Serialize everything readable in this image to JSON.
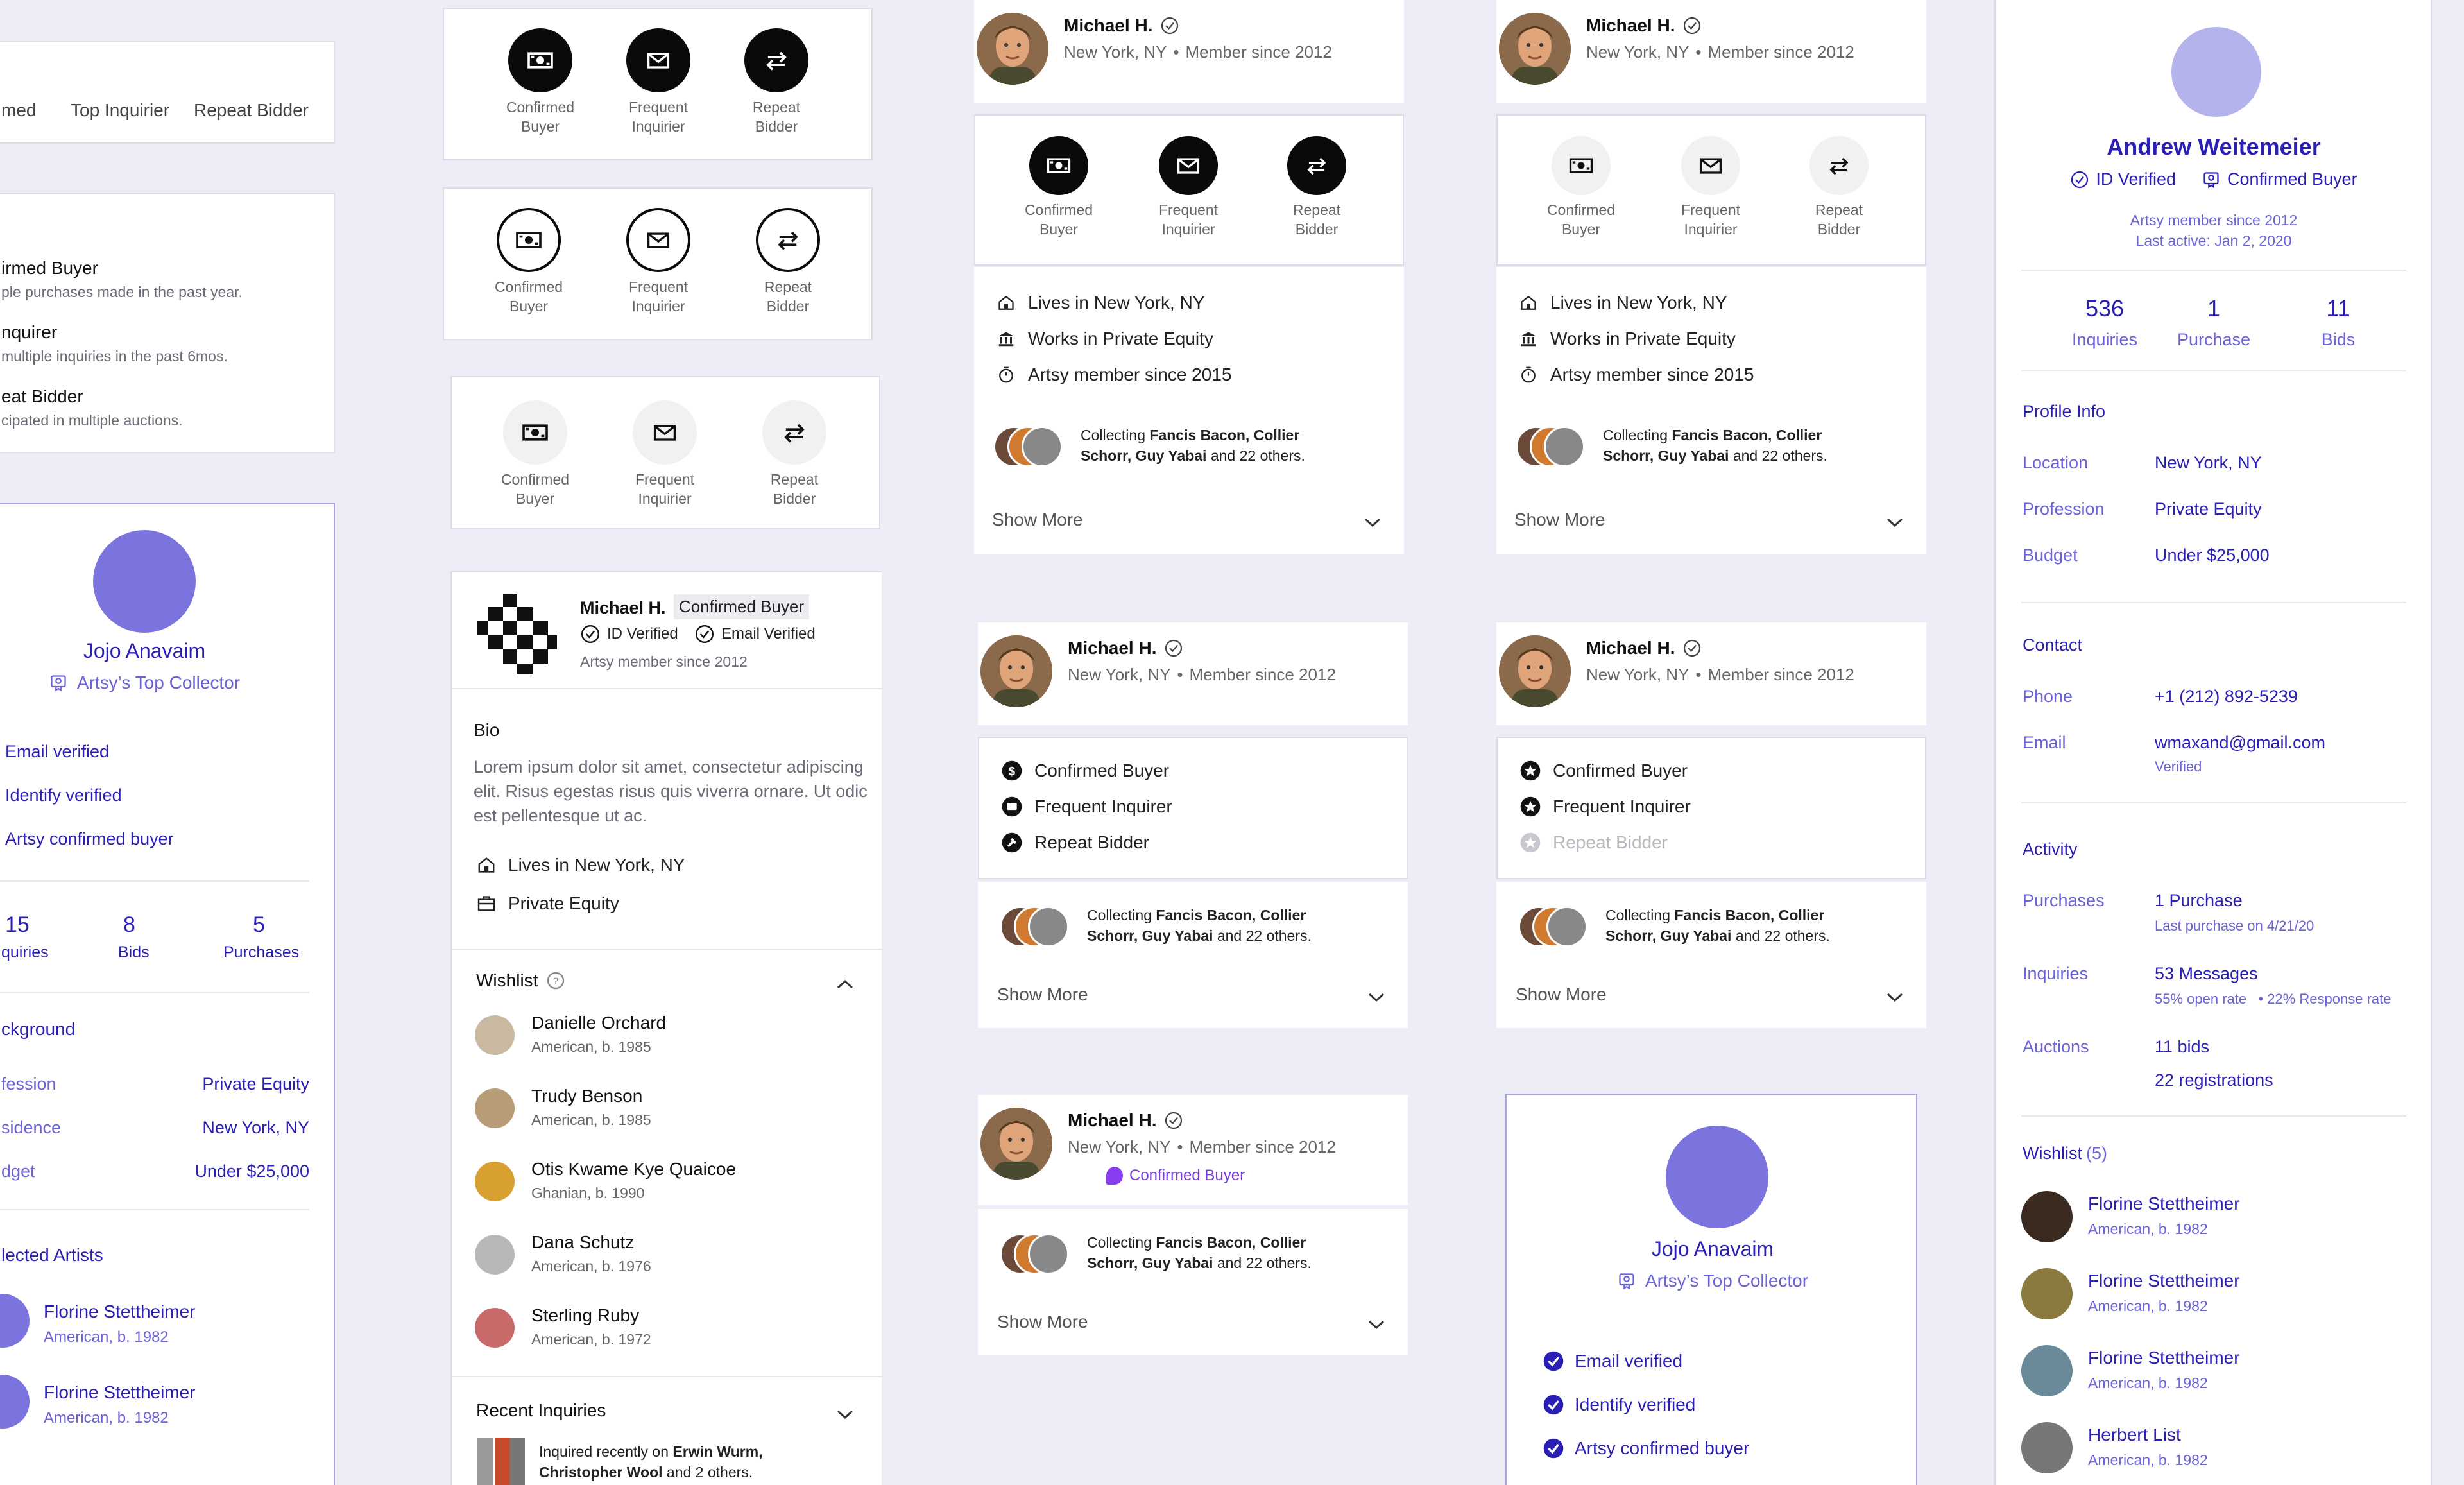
{
  "tabs_card": {
    "items": [
      "med",
      "Top Inquirier",
      "Repeat Bidder"
    ]
  },
  "desc_card": {
    "items": [
      {
        "title": "irmed Buyer",
        "desc": "ple purchases made in the past year."
      },
      {
        "title": "nquirer",
        "desc": "multiple inquiries in the past 6mos."
      },
      {
        "title": "eat Bidder",
        "desc": "cipated in multiple auctions."
      }
    ]
  },
  "badges": {
    "buyer": [
      "Confirmed",
      "Buyer"
    ],
    "inquirer": [
      "Frequent",
      "Inquirier"
    ],
    "bidder": [
      "Repeat",
      "Bidder"
    ]
  },
  "user": {
    "name": "Michael H.",
    "location": "New York, NY",
    "member": "Member since 2012",
    "sep": "•"
  },
  "details": {
    "lives": "Lives in New York, NY",
    "works": "Works in Private Equity",
    "since": "Artsy member since 2015"
  },
  "collecting": {
    "prefix": "Collecting ",
    "artists1": "Fancis Bacon, Collier",
    "artists2": "Schorr, Guy Yabai",
    "suffix": " and 22 others."
  },
  "show_more": "Show More",
  "badge_list": {
    "buyer": "Confirmed Buyer",
    "inquirer": "Frequent Inquirer",
    "bidder": "Repeat Bidder"
  },
  "confirmed_buyer_tag": "Confirmed Buyer",
  "left_profile": {
    "name": "Jojo Anavaim",
    "title": "Artsy’s Top Collector",
    "checks": [
      "Email verified",
      "Identify verified",
      "Artsy confirmed buyer"
    ],
    "stats": [
      {
        "num": "15",
        "label": "quiries"
      },
      {
        "num": "8",
        "label": "Bids"
      },
      {
        "num": "5",
        "label": "Purchases"
      }
    ],
    "background_title": "ckground",
    "background": [
      {
        "k": "fession",
        "v": "Private Equity"
      },
      {
        "k": "sidence",
        "v": "New York, NY"
      },
      {
        "k": "dget",
        "v": "Under $25,000"
      }
    ],
    "artists_title": "lected Artists",
    "artists": [
      {
        "name": "Florine Stettheimer",
        "sub": "American, b. 1982"
      },
      {
        "name": "Florine Stettheimer",
        "sub": "American, b. 1982"
      }
    ]
  },
  "detail_card": {
    "name": "Michael H.",
    "tag": "Confirmed Buyer",
    "id_verified": "ID Verified",
    "email_verified": "Email Verified",
    "member": "Artsy member since 2012",
    "bio_title": "Bio",
    "bio": [
      "Lorem ipsum dolor sit amet, consectetur adipiscing",
      "elit. Risus egestas risus quis viverra ornare. Ut odic",
      "est pellentesque ut ac."
    ],
    "lives": "Lives in New York, NY",
    "job": "Private Equity",
    "wishlist_title": "Wishlist",
    "wishlist": [
      {
        "name": "Danielle Orchard",
        "sub": "American, b. 1985",
        "c": "#c8b9a0"
      },
      {
        "name": "Trudy Benson",
        "sub": "American, b. 1985",
        "c": "#b89c78"
      },
      {
        "name": "Otis Kwame Kye Quaicoe",
        "sub": "Ghanian, b. 1990",
        "c": "#d8a030"
      },
      {
        "name": "Dana Schutz",
        "sub": "American, b. 1976",
        "c": "#b8b8b8"
      },
      {
        "name": "Sterling Ruby",
        "sub": "American, b. 1972",
        "c": "#c86a6a"
      }
    ],
    "recent_title": "Recent Inquiries",
    "recent_prefix": "Inquired recently on ",
    "recent_artist1": "Erwin Wurm,",
    "recent_artist2": "Christopher Wool",
    "recent_suffix": " and 2 others."
  },
  "bottom_profile": {
    "name": "Jojo Anavaim",
    "title": "Artsy’s Top Collector",
    "checks": [
      "Email verified",
      "Identify verified",
      "Artsy confirmed buyer"
    ]
  },
  "right_profile": {
    "name": "Andrew Weitemeier",
    "id_verified": "ID Verified",
    "confirmed": "Confirmed Buyer",
    "member": "Artsy member since 2012",
    "active": "Last active: Jan 2, 2020",
    "stats": [
      {
        "num": "536",
        "label": "Inquiries"
      },
      {
        "num": "1",
        "label": "Purchase"
      },
      {
        "num": "11",
        "label": "Bids"
      }
    ],
    "profile_title": "Profile Info",
    "profile": [
      {
        "k": "Location",
        "v": "New York, NY"
      },
      {
        "k": "Profession",
        "v": "Private Equity"
      },
      {
        "k": "Budget",
        "v": "Under $25,000"
      }
    ],
    "contact_title": "Contact",
    "phone_k": "Phone",
    "phone_v": "+1 (212) 892-5239",
    "email_k": "Email",
    "email_v": "wmaxand@gmail.com",
    "email_sub": "Verified",
    "activity_title": "Activity",
    "purchases_k": "Purchases",
    "purchases_v": "1 Purchase",
    "purchases_sub": "Last purchase on 4/21/20",
    "inquiries_k": "Inquiries",
    "inquiries_v": "53 Messages",
    "inquiries_sub": "55% open rate   • 22% Response rate",
    "auctions_k": "Auctions",
    "auctions_v1": "11 bids",
    "auctions_v2": "22 registrations",
    "wishlist_title": "Wishlist",
    "wishlist_count": "(5)",
    "wishlist": [
      {
        "name": "Florine Stettheimer",
        "sub": "American, b. 1982",
        "c": "#3a2a20"
      },
      {
        "name": "Florine Stettheimer",
        "sub": "American, b. 1982",
        "c": "#8a7a40"
      },
      {
        "name": "Florine Stettheimer",
        "sub": "American, b. 1982",
        "c": "#6a8a9a"
      },
      {
        "name": "Herbert List",
        "sub": "American, b. 1982",
        "c": "#777777"
      }
    ]
  },
  "colors": {
    "accent": "#2a1fb5",
    "lavender": "#7b74df",
    "page_bg": "#ededf8"
  }
}
